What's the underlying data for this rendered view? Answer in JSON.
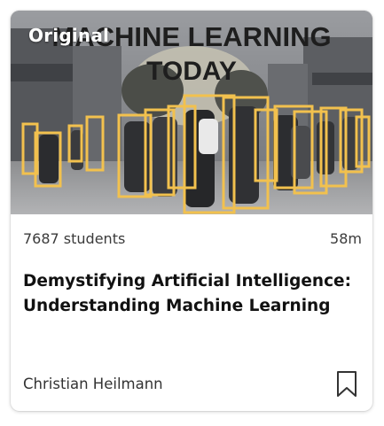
{
  "course": {
    "thumbnail": {
      "badge": "Original",
      "headline_line1": "MACHINE LEARNING",
      "headline_line2": "TODAY",
      "detection_box_color": "#f2c14e"
    },
    "students": "7687 students",
    "duration": "58m",
    "title_line1": "Demystifying Artificial Intelligence:",
    "title_line2": "Understanding Machine Learning",
    "author": "Christian Heilmann",
    "bookmark_icon": "bookmark-outline-icon"
  }
}
